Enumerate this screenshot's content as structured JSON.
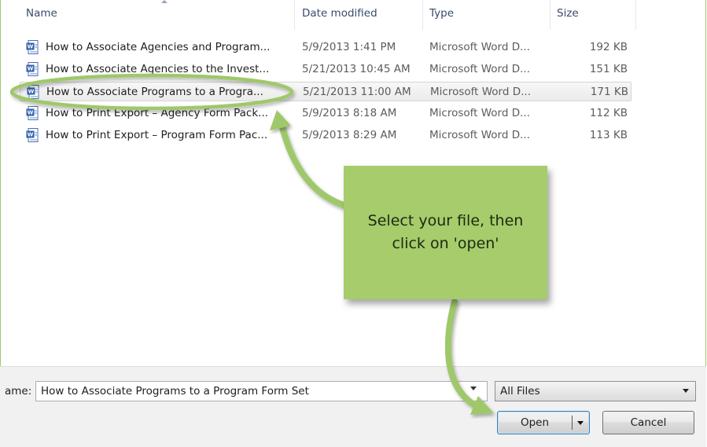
{
  "columns": {
    "name": "Name",
    "date": "Date modified",
    "type": "Type",
    "size": "Size"
  },
  "files": [
    {
      "name": "How to Associate Agencies and Program...",
      "date": "5/9/2013 1:41 PM",
      "type": "Microsoft Word D...",
      "size": "192 KB",
      "selected": false
    },
    {
      "name": "How to Associate Agencies to the Invest...",
      "date": "5/21/2013 10:45 AM",
      "type": "Microsoft Word D...",
      "size": "151 KB",
      "selected": false
    },
    {
      "name": "How to Associate Programs to a Progra...",
      "date": "5/21/2013 11:00 AM",
      "type": "Microsoft Word D...",
      "size": "171 KB",
      "selected": true
    },
    {
      "name": "How to Print Export – Agency Form Pack...",
      "date": "5/9/2013 8:18 AM",
      "type": "Microsoft Word D...",
      "size": "112 KB",
      "selected": false
    },
    {
      "name": "How to Print Export – Program Form Pac...",
      "date": "5/9/2013 8:29 AM",
      "type": "Microsoft Word D...",
      "size": "113 KB",
      "selected": false
    }
  ],
  "filename": {
    "label": "ame:",
    "value": "How to Associate Programs to a Program Form Set"
  },
  "filetype": {
    "selected": "All Files"
  },
  "buttons": {
    "open": "Open",
    "cancel": "Cancel"
  },
  "callout": {
    "line1": "Select your file, then",
    "line2": "click on 'open'"
  },
  "colors": {
    "annotation": "#a6cc6b",
    "annotation_stroke": "#9fc86a"
  },
  "icons": {
    "file": "word-document-icon"
  }
}
